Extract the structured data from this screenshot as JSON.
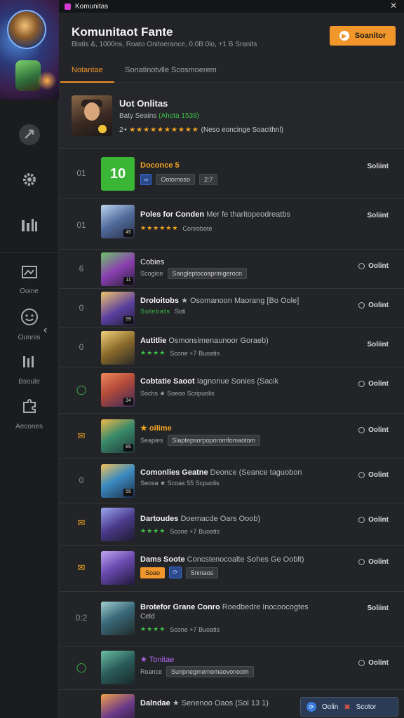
{
  "window": {
    "title": "Komunitas"
  },
  "header": {
    "title": "Komunitaot Fante",
    "subtitle": "Blatis &, 1000ns, Roato Onitoerance, 0.0B 0lo, +1 B Sranits",
    "action_label": "Soanitor"
  },
  "tabs": [
    {
      "label": "Notantae",
      "active": true
    },
    {
      "label": "Sonatinotvlle Scosmoerem",
      "active": false
    }
  ],
  "sidebar": {
    "items": [
      {
        "icon": "",
        "label": ""
      },
      {
        "icon": "",
        "label": ""
      },
      {
        "icon": "",
        "label": ""
      },
      {
        "icon": "",
        "label": "Ooine"
      },
      {
        "icon": "",
        "label": "Ounnis"
      },
      {
        "icon": "",
        "label": "Bsoule"
      },
      {
        "icon": "",
        "label": "Aecones"
      }
    ]
  },
  "featured": {
    "title": "Uot Onlitas",
    "sub_prefix": "Baty Seains",
    "sub_green": "(Ahota 1539)",
    "rating_prefix": "2+",
    "stars": "★★★★★★★★★★",
    "rating_text": "(Neso eoncinge Soacithnl)"
  },
  "rows": [
    {
      "rank": "01",
      "name": "Doconce 5",
      "desc": "",
      "meta": [
        "Ootomoso",
        "2:7"
      ],
      "action": "Soliint",
      "action_icon": false,
      "name_style": "orange"
    },
    {
      "rank": "01",
      "name": "Poles for Conden",
      "desc": "Mer fe tharitopeodreatbs",
      "meta_rating": "★★★★★★",
      "meta_text": "Conrobote",
      "action": "Soliint",
      "action_icon": false,
      "lvl": "45"
    },
    {
      "rank": "6",
      "name": "Cobies",
      "desc": "",
      "meta": [
        "Scogioe",
        "Sangleptocoaprinigerocn"
      ],
      "action": "Oolint",
      "action_icon": true,
      "lvl": "11"
    },
    {
      "rank": "0",
      "name": "Droloitobs",
      "desc": "★ Osomanoon Maorang [Bo Oole]",
      "meta_green": "Solebats",
      "meta_text": "Soti",
      "action": "Oolint",
      "action_icon": true,
      "lvl": "59"
    },
    {
      "rank": "0",
      "name": "Autitlie",
      "desc": "Osmonsimenaunoor Goraeb)",
      "meta_green": "★★★★",
      "meta_text": "Scone +7 Buoatis",
      "action": "Soliint",
      "action_icon": false
    },
    {
      "rank": "ok",
      "name": "Cobtatie Saoot",
      "desc": "Iagnonue Sonies (Sacik",
      "meta_text": "Sochs ★  Soeoo Scripuolis",
      "action": "Oolint",
      "action_icon": true,
      "lvl": "34"
    },
    {
      "rank": "badge",
      "name": "★ oilime",
      "desc": "",
      "meta": [
        "Seapies",
        "Slaptepsorpoporomfomaotom"
      ],
      "action": "Oolint",
      "action_icon": true,
      "lvl": "85",
      "name_style": "orange"
    },
    {
      "rank": "0",
      "name": "Comonlies Geatne",
      "desc": "Deonce (Seance taguobon",
      "meta_text": "Seosa ★  Scoas 55 Scpuolis",
      "action": "Oolint",
      "action_icon": true,
      "lvl": "55"
    },
    {
      "rank": "badge",
      "name": "Dartoudes",
      "desc": "Doemacde Oars Ooob)",
      "meta_green": "★★★★",
      "meta_text": "Scone +7 Buoatis",
      "action": "Oolint",
      "action_icon": true
    },
    {
      "rank": "badge",
      "name": "Dams Soote",
      "desc": "Concstenocoalte Sohes Ge Ooblt)",
      "meta_chips": [
        "Soao",
        "Sninaos"
      ],
      "action": "Oolint",
      "action_icon": true
    },
    {
      "rank": "0:2",
      "name": "Brotefor Grane Conro",
      "desc": "Roedbedre Inocoocogtes",
      "line2": "Celd",
      "meta_green": "★★★★",
      "meta_text": "Scone +7 Buoatis",
      "action": "Soliint",
      "action_icon": false
    },
    {
      "rank": "ok",
      "name": "★ Tonitae",
      "desc": "",
      "meta": [
        "Roance",
        "Sunpnegmemomaovonoom"
      ],
      "action": "Oolint",
      "action_icon": true,
      "name_style": "purple"
    },
    {
      "rank": "",
      "name": "Dalndae",
      "desc": "★ Senenoo Oaos (Sol 13 1)",
      "action": "",
      "action_icon": false
    }
  ],
  "float_bar": {
    "left": "Oolin",
    "right": "Scotor"
  },
  "colors": {
    "accent": "#f0962a",
    "green": "#3ec24a",
    "bg": "#232427"
  }
}
